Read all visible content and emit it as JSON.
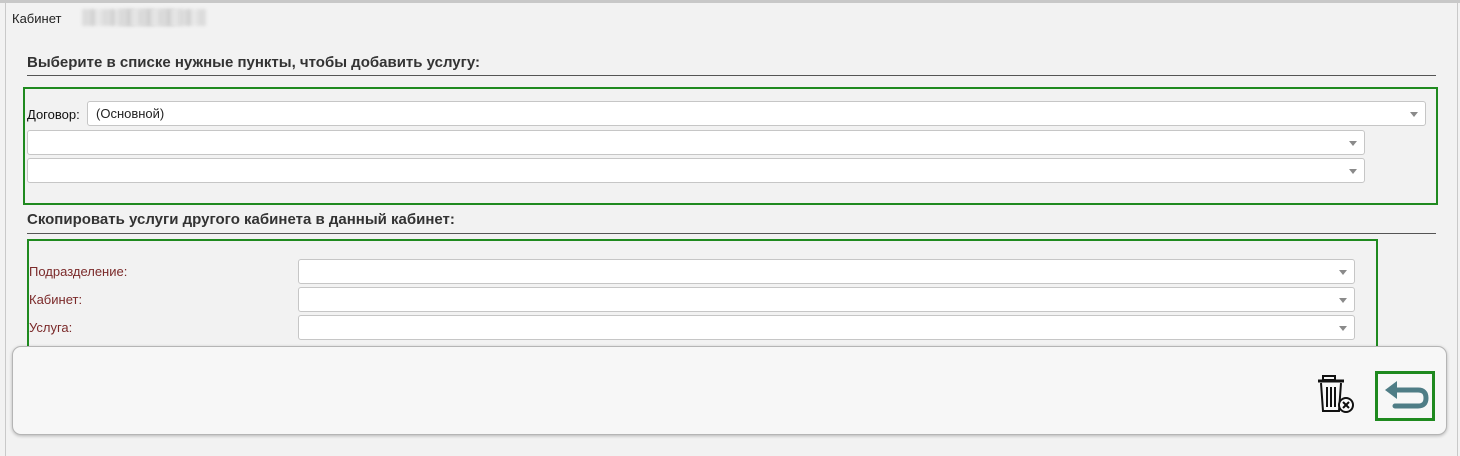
{
  "header": {
    "cabinet_label": "Кабинет"
  },
  "add_service": {
    "title": "Выберите в списке нужные пункты, чтобы добавить услугу:",
    "contract_label": "Договор:",
    "contract_value": "(Основной)",
    "select2_value": "",
    "select3_value": ""
  },
  "copy_services": {
    "title": "Скопировать услуги другого кабинета в данный кабинет:",
    "fields": [
      {
        "label": "Подразделение:",
        "value": ""
      },
      {
        "label": "Кабинет:",
        "value": ""
      },
      {
        "label": "Услуга:",
        "value": ""
      }
    ]
  },
  "footer": {
    "delete_icon": "trash-x-icon",
    "back_icon": "undo-arrow-icon"
  },
  "colors": {
    "highlight_border": "#1f8a1f",
    "field_label": "#7b2a2a",
    "background": "#f2f2f2"
  }
}
